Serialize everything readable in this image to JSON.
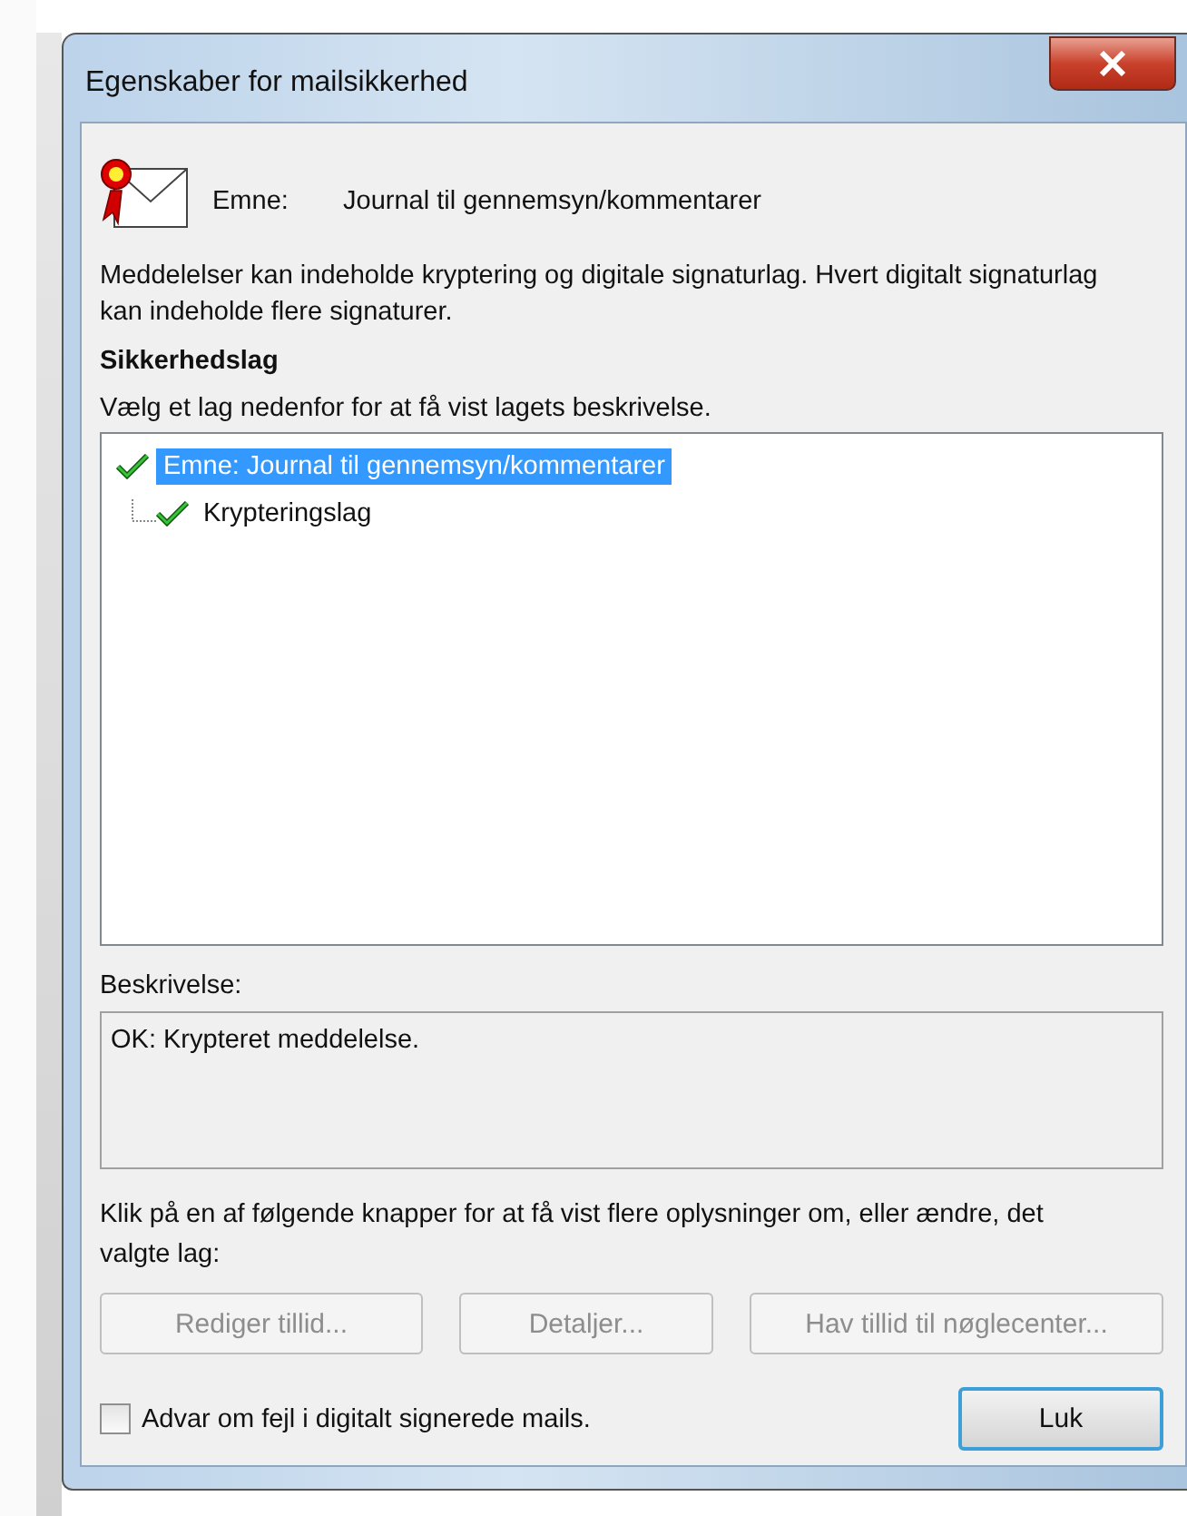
{
  "window": {
    "title": "Egenskaber for mailsikkerhed"
  },
  "subject": {
    "label": "Emne:",
    "value": "Journal til gennemsyn/kommentarer"
  },
  "intro": "Meddelelser kan indeholde kryptering og digitale signaturlag. Hvert digitalt signaturlag kan indeholde flere signaturer.",
  "layers": {
    "heading": "Sikkerhedslag",
    "hint": "Vælg et lag nedenfor for at få vist lagets beskrivelse.",
    "items": [
      {
        "label": "Emne: Journal til gennemsyn/kommentarer",
        "selected": true,
        "children": [
          {
            "label": "Krypteringslag",
            "selected": false
          }
        ]
      }
    ]
  },
  "description": {
    "label": "Beskrivelse:",
    "text": "OK: Krypteret meddelelse."
  },
  "actions_hint": "Klik på en af følgende knapper for at få vist flere oplysninger om, eller ændre, det valgte lag:",
  "actions": [
    {
      "label": "Rediger tillid...",
      "disabled": true
    },
    {
      "label": "Detaljer...",
      "disabled": true
    },
    {
      "label": "Hav tillid til nøglecenter...",
      "disabled": true
    }
  ],
  "warn_checkbox": {
    "label": "Advar om fejl i digitalt signerede mails.",
    "checked": false
  },
  "close_button": {
    "label": "Luk",
    "focused": true
  }
}
